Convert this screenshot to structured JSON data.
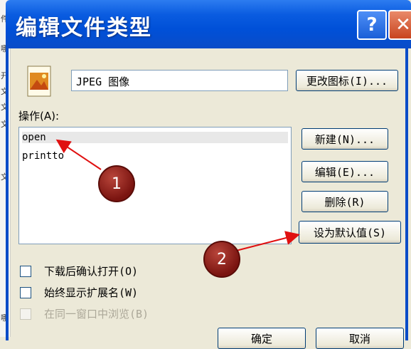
{
  "window": {
    "title": "编辑文件类型",
    "help_label": "?",
    "close_label": "✕"
  },
  "file_type": {
    "name_value": "JPEG 图像",
    "change_icon_label": "更改图标(I)..."
  },
  "actions": {
    "label": "操作(A):",
    "items": [
      "open",
      "printto"
    ],
    "selected_index": 0
  },
  "buttons": {
    "new_label": "新建(N)...",
    "edit_label": "编辑(E)...",
    "delete_label": "删除(R)",
    "set_default_label": "设为默认值(S)",
    "ok_label": "确定",
    "cancel_label": "取消"
  },
  "options": [
    {
      "label": "下载后确认打开(O)",
      "checked": false,
      "disabled": false
    },
    {
      "label": "始终显示扩展名(W)",
      "checked": false,
      "disabled": false
    },
    {
      "label": "在同一窗口中浏览(B)",
      "checked": false,
      "disabled": true
    }
  ],
  "annotations": [
    {
      "number": "1"
    },
    {
      "number": "2"
    }
  ],
  "background_strip_chars": [
    "件",
    "哪",
    "开",
    "文",
    "文",
    "文",
    "文",
    "哪"
  ],
  "colors": {
    "titlebar": "#0a5ce0",
    "dialog_bg": "#ece9d8",
    "annotation": "#7a1410",
    "arrow": "#e01010"
  }
}
